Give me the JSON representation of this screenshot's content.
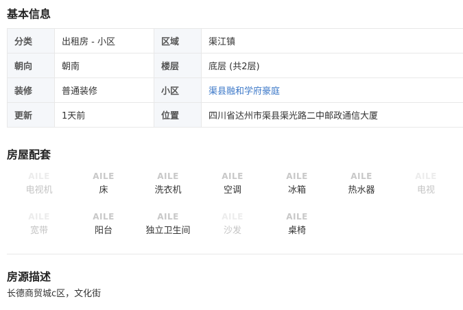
{
  "basic_info": {
    "title": "基本信息",
    "rows": [
      {
        "k1": "分类",
        "v1": "出租房 - 小区",
        "k2": "区域",
        "v2": "渠江镇"
      },
      {
        "k1": "朝向",
        "v1": "朝南",
        "k2": "楼层",
        "v2": "底层 (共2层)"
      },
      {
        "k1": "装修",
        "v1": "普通装修",
        "k2": "小区",
        "v2": "渠县融和学府豪庭"
      },
      {
        "k1": "更新",
        "v1": "1天前",
        "k2": "位置",
        "v2": "四川省达州市渠县渠光路二中邮政通信大厦"
      }
    ]
  },
  "facilities": {
    "title": "房屋配套",
    "icon_text": "AILE",
    "items": [
      {
        "label": "电视机",
        "available": false
      },
      {
        "label": "床",
        "available": true
      },
      {
        "label": "洗衣机",
        "available": true
      },
      {
        "label": "空调",
        "available": true
      },
      {
        "label": "冰箱",
        "available": true
      },
      {
        "label": "热水器",
        "available": true
      },
      {
        "label": "电视",
        "available": false
      },
      {
        "label": "宽带",
        "available": false
      },
      {
        "label": "阳台",
        "available": true
      },
      {
        "label": "独立卫生间",
        "available": true
      },
      {
        "label": "沙发",
        "available": false
      },
      {
        "label": "桌椅",
        "available": true
      }
    ]
  },
  "description": {
    "title": "房源描述",
    "text": "长德商贸城c区，文化街"
  },
  "colors": {
    "link": "#3c78c8",
    "label_bg": "#f5f7fa",
    "border": "#e8e8e8"
  }
}
